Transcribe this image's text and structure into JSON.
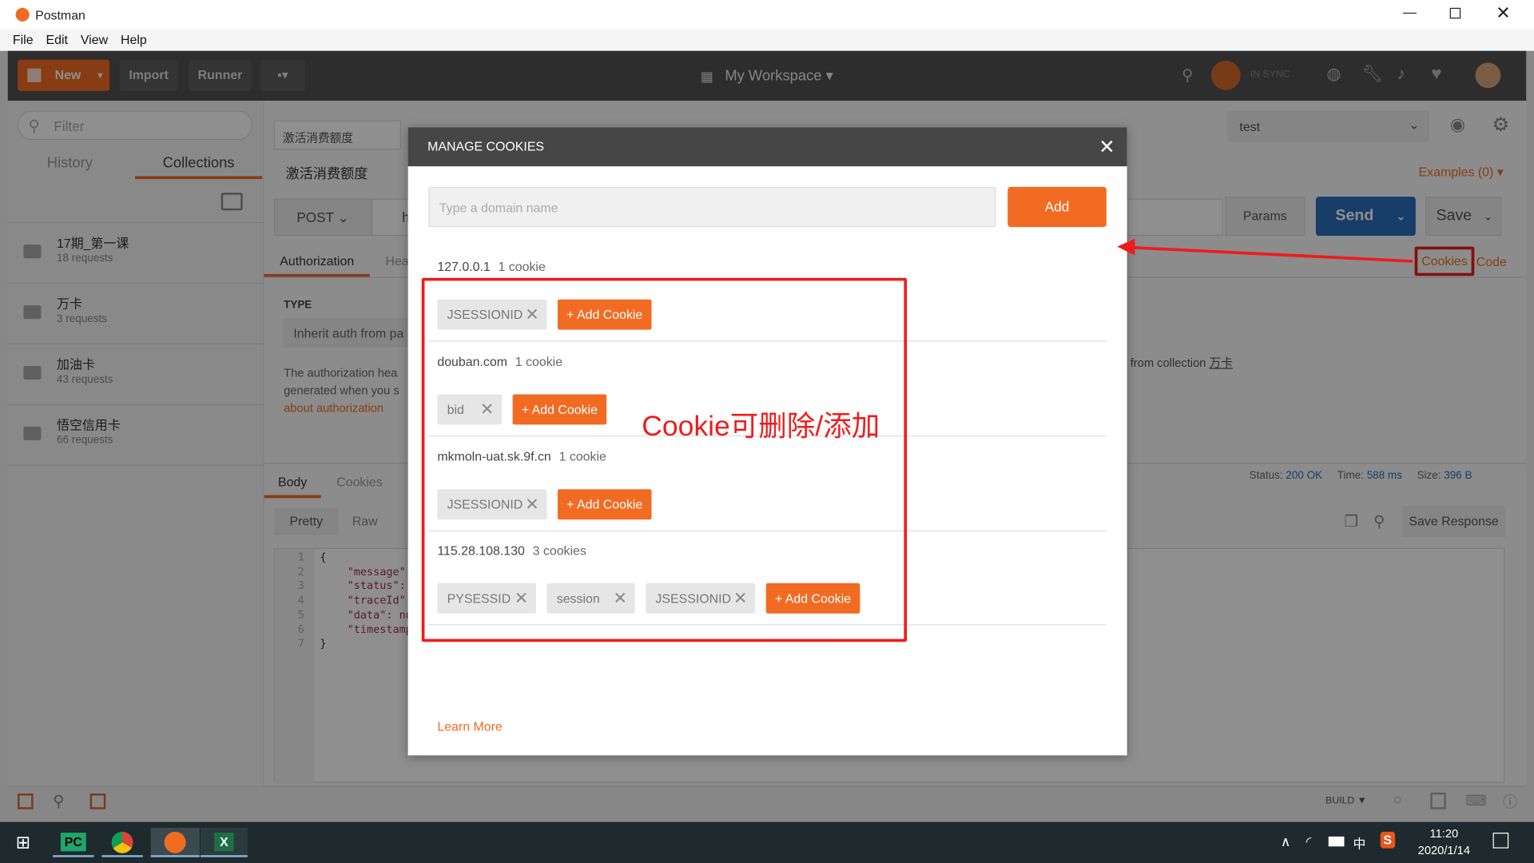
{
  "window": {
    "title": "Postman",
    "menu": [
      "File",
      "Edit",
      "View",
      "Help"
    ]
  },
  "header": {
    "new": "New",
    "import": "Import",
    "runner": "Runner",
    "workspace": "My Workspace",
    "sync": "IN SYNC"
  },
  "sidebar": {
    "filter_placeholder": "Filter",
    "tabs": [
      "History",
      "Collections"
    ],
    "collections": [
      {
        "name": "17期_第一课",
        "count": "18 requests"
      },
      {
        "name": "万卡",
        "count": "3 requests"
      },
      {
        "name": "加油卡",
        "count": "43 requests"
      },
      {
        "name": "悟空信用卡",
        "count": "66 requests"
      }
    ]
  },
  "request": {
    "tab": "激活消费额度",
    "name": "激活消费额度",
    "method": "POST",
    "url_partial": "h",
    "env": "test",
    "examples": "Examples (0)",
    "params": "Params",
    "send": "Send",
    "save": "Save",
    "cookies": "Cookies",
    "code": "Code",
    "subtabs": [
      "Authorization",
      "Hea"
    ],
    "type_label": "TYPE",
    "type_value": "Inherit auth from pa",
    "auth_text": [
      "The authorization hea",
      "generated when you s"
    ],
    "auth_link": "about authorization",
    "inherit_text": "r from collection",
    "inherit_link": "万卡"
  },
  "response": {
    "tabs": [
      "Body",
      "Cookies"
    ],
    "views": [
      "Pretty",
      "Raw"
    ],
    "status_label": "Status:",
    "status": "200 OK",
    "time_label": "Time:",
    "time": "588 ms",
    "size_label": "Size:",
    "size": "396 B",
    "save_response": "Save Response",
    "lines": [
      "{",
      "\"message\":",
      "\"status\":",
      "\"traceId\":",
      "\"data\": nu",
      "\"timestamp",
      "}"
    ]
  },
  "statusbar": {
    "build": "BUILD ▼"
  },
  "modal": {
    "title": "MANAGE COOKIES",
    "input_placeholder": "Type a domain name",
    "add": "Add",
    "add_cookie": "+ Add Cookie",
    "learn_more": "Learn More",
    "domains": [
      {
        "domain": "127.0.0.1",
        "count": "1 cookie",
        "cookies": [
          "JSESSIONID"
        ]
      },
      {
        "domain": "douban.com",
        "count": "1 cookie",
        "cookies": [
          "bid"
        ]
      },
      {
        "domain": "mkmoln-uat.sk.9f.cn",
        "count": "1 cookie",
        "cookies": [
          "JSESSIONID"
        ]
      },
      {
        "domain": "115.28.108.130",
        "count": "3 cookies",
        "cookies": [
          "PYSESSID",
          "session",
          "JSESSIONID"
        ]
      }
    ]
  },
  "annotation": {
    "text": "Cookie可删除/添加",
    "color": "#ee1c1c"
  },
  "taskbar": {
    "time": "11:20",
    "date": "2020/1/14",
    "ime": "中"
  },
  "colors": {
    "accent": "#f26b22",
    "send": "#2a6ebb",
    "link": "#2a6ebb"
  }
}
